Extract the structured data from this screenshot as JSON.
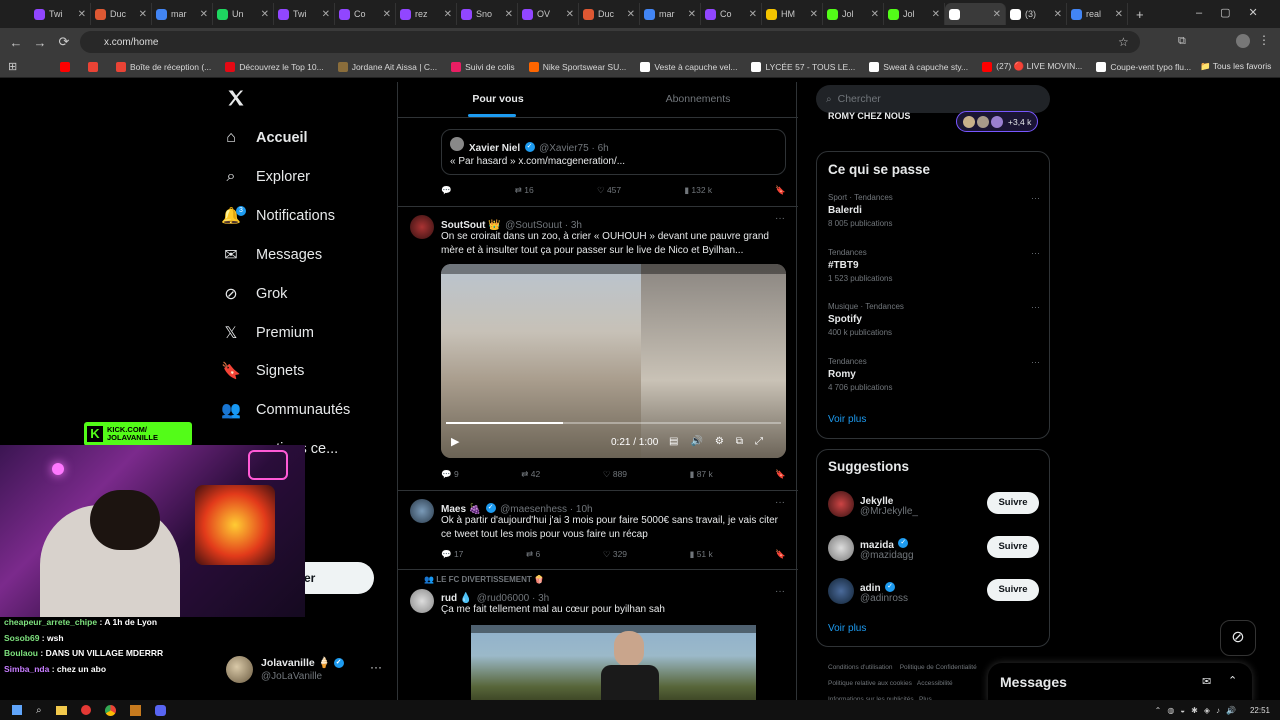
{
  "browser": {
    "tabs": [
      {
        "label": "Twi",
        "color": "#9146ff"
      },
      {
        "label": "Duc",
        "color": "#de5833"
      },
      {
        "label": "mar",
        "color": "#4285f4"
      },
      {
        "label": "Un",
        "color": "#1ed760"
      },
      {
        "label": "Twi",
        "color": "#9146ff"
      },
      {
        "label": "Co",
        "color": "#9146ff"
      },
      {
        "label": "rez",
        "color": "#9146ff"
      },
      {
        "label": "Sno",
        "color": "#9146ff"
      },
      {
        "label": "OV",
        "color": "#9146ff"
      },
      {
        "label": "Duc",
        "color": "#de5833"
      },
      {
        "label": "mar",
        "color": "#4285f4"
      },
      {
        "label": "Co",
        "color": "#9146ff"
      },
      {
        "label": "HM",
        "color": "#f4c400"
      },
      {
        "label": "Jol",
        "color": "#53fc18"
      },
      {
        "label": "Jol",
        "color": "#53fc18"
      },
      {
        "label": "",
        "color": "#ffffff",
        "active": true
      },
      {
        "label": "(3)",
        "color": "#ffffff"
      },
      {
        "label": "real",
        "color": "#4285f4"
      }
    ],
    "url": "x.com/home",
    "bookmarks": [
      {
        "label": "",
        "color": "#ff0000"
      },
      {
        "label": "",
        "color": "#ea4335"
      },
      {
        "label": "Boîte de réception (...",
        "color": "#ea4335"
      },
      {
        "label": "Découvrez le Top 10...",
        "color": "#e50914"
      },
      {
        "label": "Jordane Ait Aissa | C...",
        "color": "#8a6d3b"
      },
      {
        "label": "Suivi de colis",
        "color": "#e91e63"
      },
      {
        "label": "Nike Sportswear SU...",
        "color": "#ff6600"
      },
      {
        "label": "Veste à capuche vel...",
        "color": "#ffffff"
      },
      {
        "label": "LYCÉE 57 - TOUS LE...",
        "color": "#ffffff"
      },
      {
        "label": "Sweat à capuche sty...",
        "color": "#ffffff"
      },
      {
        "label": "(27) 🔴 LIVE MOVIN...",
        "color": "#ff0000"
      },
      {
        "label": "Coupe-vent typo flu...",
        "color": "#ffffff"
      }
    ],
    "all_favorites": "Tous les favoris"
  },
  "nav": {
    "items": [
      {
        "label": "Accueil",
        "icon": "home-icon",
        "bold": true
      },
      {
        "label": "Explorer",
        "icon": "search-icon"
      },
      {
        "label": "Notifications",
        "icon": "bell-icon"
      },
      {
        "label": "Messages",
        "icon": "mail-icon"
      },
      {
        "label": "Grok",
        "icon": "grok-icon"
      },
      {
        "label": "Premium",
        "icon": "x-icon"
      },
      {
        "label": "Signets",
        "icon": "bookmark-icon"
      },
      {
        "label": "Communautés",
        "icon": "people-icon"
      },
      {
        "label": "...ations ce...",
        "icon": "more-icon"
      }
    ],
    "notif_badge": "3",
    "profile": {
      "name": "Jolavanille",
      "handle": "@JoLaVanille"
    }
  },
  "feed": {
    "tabs": [
      "Pour vous",
      "Abonnements"
    ],
    "quote": {
      "name": "Xavier Niel",
      "handle": "@Xavier75 · 6h",
      "text": "« Par hasard » x.com/macgeneration/..."
    },
    "quote_actions": {
      "likes": "457",
      "retweets": "16",
      "views": "132 k"
    },
    "tweets": [
      {
        "name": "SoutSout 👑",
        "handle": "@SoutSouut · 3h",
        "text": "On se croirait dans un zoo, à crier « OUHOUH » devant une pauvre grand mère et à insulter tout ça pour passer sur le live de Nico et Byilhan...",
        "video_time": "0:21 / 1:00",
        "actions": {
          "replies": "9",
          "retweets": "42",
          "likes": "889",
          "views": "87 k"
        }
      },
      {
        "name": "Maes 🍇",
        "handle": "@maesenhess · 10h",
        "text": "Ok à partir d'aujourd'hui j'ai 3 mois pour faire 5000€ sans travail, je vais citer ce tweet tout les mois pour vous faire un récap",
        "actions": {
          "replies": "17",
          "retweets": "6",
          "likes": "329",
          "views": "51 k"
        }
      },
      {
        "context": "LE FC DIVERTISSEMENT 🍿",
        "name": "rud 💧",
        "handle": "@rud06000 · 3h",
        "text": "Ça me fait tellement mal au cœur pour byilhan sah"
      }
    ]
  },
  "right": {
    "search_placeholder": "Chercher",
    "live_label": "ROMY CHEZ NOUS",
    "live_count": "+3,4 k",
    "happening_title": "Ce qui se passe",
    "trends": [
      {
        "meta": "Sport · Tendances",
        "name": "Balerdi",
        "count": "8 005 publications"
      },
      {
        "meta": "Tendances",
        "name": "#TBT9",
        "count": "1 523 publications"
      },
      {
        "meta": "Musique · Tendances",
        "name": "Spotify",
        "count": "400 k publications"
      },
      {
        "meta": "Tendances",
        "name": "Romy",
        "count": "4 706 publications"
      }
    ],
    "show_more": "Voir plus",
    "suggestions_title": "Suggestions",
    "suggestions": [
      {
        "name": "Jekylle",
        "handle": "@MrJekylle_",
        "verified": false
      },
      {
        "name": "mazida",
        "handle": "@mazidagg",
        "verified": true
      },
      {
        "name": "adin",
        "handle": "@adinross",
        "verified": true
      }
    ],
    "follow_label": "Suivre",
    "footer": [
      "Conditions d'utilisation",
      "Politique de Confidentialité",
      "Politique relative aux cookies",
      "Accessibilité",
      "Informations sur les publicités",
      "Plus ..."
    ],
    "messages_title": "Messages"
  },
  "stream": {
    "kick_label": "KICK.COM/ JOLAVANILLE",
    "chat": [
      {
        "user": "cheapeur_arrete_chipe",
        "color": "#7ee27e",
        "msg": "A 1h de Lyon"
      },
      {
        "user": "Sosob69",
        "color": "#7ee27e",
        "msg": "wsh"
      },
      {
        "user": "Boulaou",
        "color": "#7ee27e",
        "msg": "DANS UN VILLAGE MDERRR"
      },
      {
        "user": "Simba_nda",
        "color": "#c77dff",
        "msg": "chez un abo"
      }
    ]
  },
  "taskbar": {
    "time": "22:51"
  }
}
